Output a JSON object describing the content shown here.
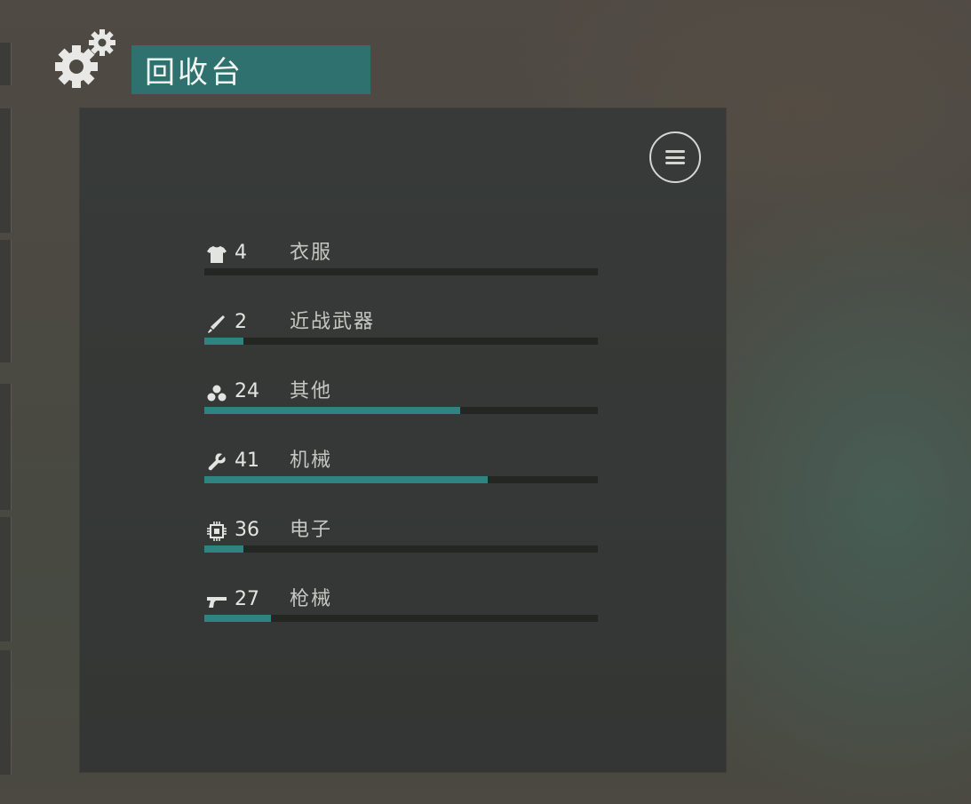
{
  "header": {
    "title": "回收台",
    "icon": "gears-icon"
  },
  "panel": {
    "menu_icon": "menu-icon"
  },
  "categories": [
    {
      "icon": "shirt-icon",
      "count": "4",
      "label": "衣服",
      "progress": 0.0
    },
    {
      "icon": "knife-icon",
      "count": "2",
      "label": "近战武器",
      "progress": 0.1
    },
    {
      "icon": "dots-icon",
      "count": "24",
      "label": "其他",
      "progress": 0.65
    },
    {
      "icon": "wrench-icon",
      "count": "41",
      "label": "机械",
      "progress": 0.72
    },
    {
      "icon": "chip-icon",
      "count": "36",
      "label": "电子",
      "progress": 0.1
    },
    {
      "icon": "gun-icon",
      "count": "27",
      "label": "枪械",
      "progress": 0.17
    }
  ],
  "colors": {
    "accent": "#2f716e",
    "bar_fill": "#2d8480",
    "bar_track": "#242624",
    "panel": "#363937"
  }
}
